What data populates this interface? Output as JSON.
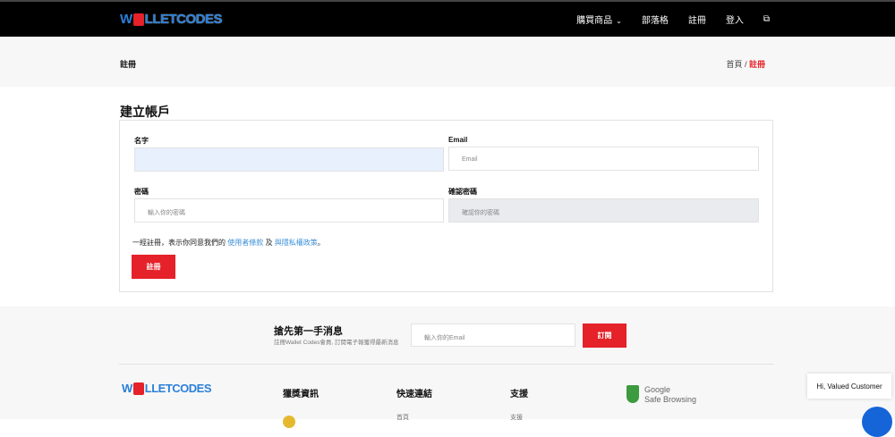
{
  "header": {
    "logo": "WALLETCODES",
    "nav": [
      "購買商品",
      "部落格",
      "註冊",
      "登入"
    ],
    "translate_icon": "translate-icon"
  },
  "crumbbar": {
    "title": "註冊",
    "breadcrumb": [
      "首頁",
      "註冊"
    ],
    "separator": "/"
  },
  "form": {
    "heading": "建立帳戶",
    "name_label": "名字",
    "name_value": "",
    "email_label": "Email",
    "email_placeholder": "Email",
    "password_label": "密碼",
    "password_placeholder": "輸入你的密碼",
    "confirm_label": "確認密碼",
    "confirm_placeholder": "確認你的密碼",
    "agree_text": "一經註冊，表示你同意我們的",
    "terms_link": "使用者條款",
    "and": "及",
    "privacy_link": "與隱私權政策",
    "period": "。",
    "submit": "註冊"
  },
  "newsletter": {
    "title": "搶先第一手消息",
    "desc": "註冊Wallet Codes會員, 訂閱電子報獲得最新消息",
    "placeholder": "輸入你的Email",
    "button": "訂閱"
  },
  "footer": {
    "logo": "WALLETCODES",
    "columns": [
      "獵獎資訊",
      "快速連結",
      "支援"
    ],
    "links": {
      "quick": "首頁",
      "support": "支援"
    },
    "gsb": [
      "Google",
      "Safe Browsing"
    ]
  },
  "chat": {
    "greeting": "Hi, Valued Customer"
  }
}
